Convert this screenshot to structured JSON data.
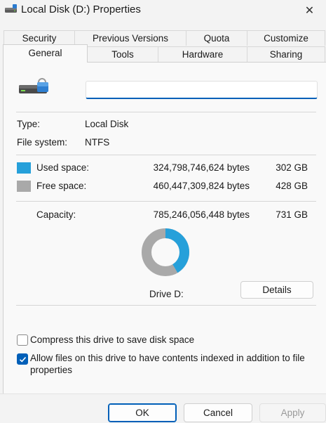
{
  "window": {
    "title": "Local Disk (D:) Properties",
    "close_glyph": "✕"
  },
  "tabs": {
    "row1": [
      "Security",
      "Previous Versions",
      "Quota",
      "Customize"
    ],
    "row2": [
      "General",
      "Tools",
      "Hardware",
      "Sharing"
    ],
    "active": "General"
  },
  "general": {
    "name_value": "",
    "type_label": "Type:",
    "type_value": "Local Disk",
    "fs_label": "File system:",
    "fs_value": "NTFS",
    "used": {
      "label": "Used space:",
      "bytes": "324,798,746,624 bytes",
      "size": "302 GB",
      "color": "#26a0da"
    },
    "free": {
      "label": "Free space:",
      "bytes": "460,447,309,824 bytes",
      "size": "428 GB",
      "color": "#a9a9a9"
    },
    "capacity": {
      "label": "Capacity:",
      "bytes": "785,246,056,448 bytes",
      "size": "731 GB"
    },
    "used_fraction": 0.4136,
    "drive_label": "Drive D:",
    "details_button": "Details",
    "compress_label": "Compress this drive to save disk space",
    "compress_checked": false,
    "index_label_line1": "Allow files on this drive to have contents indexed in addition to file",
    "index_label_line2": "properties",
    "index_checked": true
  },
  "footer": {
    "ok": "OK",
    "cancel": "Cancel",
    "apply": "Apply"
  },
  "colors": {
    "accent": "#005fb8",
    "used": "#26a0da",
    "free": "#a9a9a9"
  }
}
